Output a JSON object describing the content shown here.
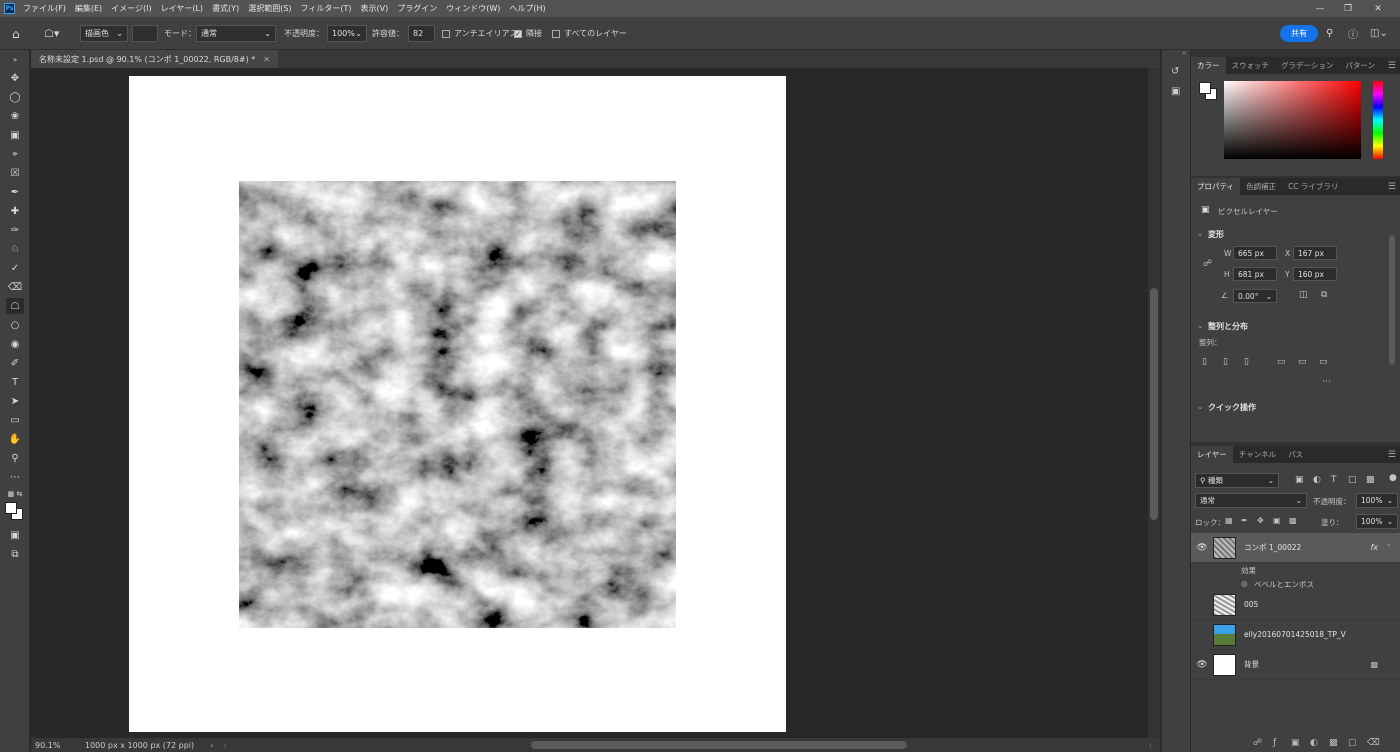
{
  "app": {
    "logo": "Ps"
  },
  "menu": [
    "ファイル(F)",
    "編集(E)",
    "イメージ(I)",
    "レイヤー(L)",
    "書式(Y)",
    "選択範囲(S)",
    "フィルター(T)",
    "表示(V)",
    "プラグイン",
    "ウィンドウ(W)",
    "ヘルプ(H)"
  ],
  "options": {
    "fill_source": "描画色",
    "mode_label": "モード：",
    "mode_value": "通常",
    "opacity_label": "不透明度：",
    "opacity_value": "100%",
    "tolerance_label": "許容値：",
    "tolerance_value": "82",
    "antialias_label": "アンチエイリアス",
    "contiguous_label": "隣接",
    "all_layers_label": "すべてのレイヤー",
    "share_label": "共有"
  },
  "document": {
    "tab_title": "名称未設定 1.psd @ 90.1% (コンポ 1_00022, RGB/8#) *",
    "zoom": "90.1%",
    "size_info": "1000 px x 1000 px (72 ppi)"
  },
  "panels": {
    "color_tabs": [
      "カラー",
      "スウォッチ",
      "グラデーション",
      "パターン"
    ],
    "prop_tabs": [
      "プロパティ",
      "色調補正",
      "CC ライブラリ"
    ],
    "pixel_layer": "ピクセルレイヤー",
    "transform_title": "変形",
    "w_label": "W",
    "w_value": "665 px",
    "x_label": "X",
    "x_value": "167 px",
    "h_label": "H",
    "h_value": "681 px",
    "y_label": "Y",
    "y_value": "160 px",
    "angle_value": "0.00°",
    "align_title": "整列と分布",
    "align_label": "整列：",
    "quick_title": "クイック操作",
    "layer_tabs": [
      "レイヤー",
      "チャンネル",
      "パス"
    ],
    "kind_value": "種類",
    "blend_value": "通常",
    "opacity_label": "不透明度：",
    "opacity_value": "100%",
    "lock_label": "ロック：",
    "fill_label": "塗り：",
    "fill_value": "100%",
    "effect_label": "効果",
    "bevel_label": "ベベルとエンボス",
    "fx": "fx"
  },
  "layers": [
    {
      "name": "コンポ 1_00022",
      "visible": true,
      "selected": true
    },
    {
      "name": "005",
      "visible": false,
      "selected": false
    },
    {
      "name": "elly20160701425018_TP_V",
      "visible": false,
      "selected": false
    },
    {
      "name": "背景",
      "visible": true,
      "selected": false
    }
  ],
  "colors": {
    "accent": "#1473e6",
    "foreground": "#ffffff",
    "background": "#ffffff"
  }
}
